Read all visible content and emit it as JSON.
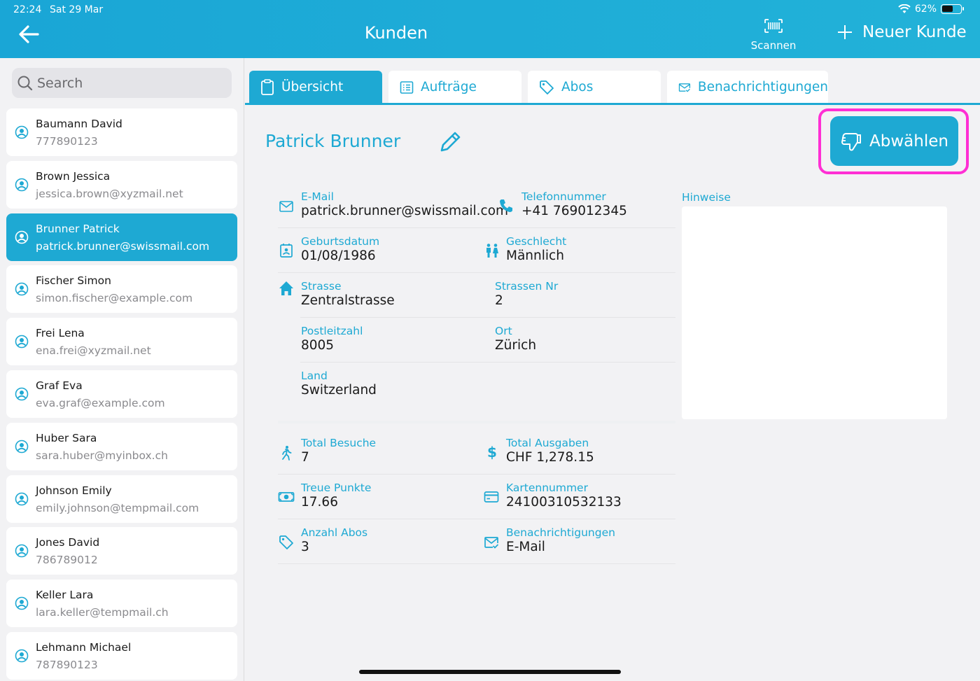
{
  "status_bar": {
    "time": "22:24",
    "date": "Sat 29 Mar",
    "battery": "62%"
  },
  "header": {
    "title": "Kunden",
    "scan_label": "Scannen",
    "new_label": "Neuer Kunde"
  },
  "search": {
    "placeholder": "Search"
  },
  "customers": [
    {
      "name": "Baumann David",
      "sub": "777890123"
    },
    {
      "name": "Brown Jessica",
      "sub": "jessica.brown@xyzmail.net"
    },
    {
      "name": "Brunner Patrick",
      "sub": "patrick.brunner@swissmail.com",
      "active": true
    },
    {
      "name": "Fischer Simon",
      "sub": "simon.fischer@example.com"
    },
    {
      "name": "Frei Lena",
      "sub": "ena.frei@xyzmail.net"
    },
    {
      "name": "Graf Eva",
      "sub": "eva.graf@example.com"
    },
    {
      "name": "Huber Sara",
      "sub": "sara.huber@myinbox.ch"
    },
    {
      "name": "Johnson Emily",
      "sub": "emily.johnson@tempmail.com"
    },
    {
      "name": "Jones David",
      "sub": "786789012"
    },
    {
      "name": "Keller Lara",
      "sub": "lara.keller@tempmail.ch"
    },
    {
      "name": "Lehmann Michael",
      "sub": "787890123"
    }
  ],
  "tabs": [
    {
      "label": "Übersicht",
      "active": true
    },
    {
      "label": "Aufträge"
    },
    {
      "label": "Abos"
    },
    {
      "label": "Benachrichtigungen"
    }
  ],
  "detail": {
    "name": "Patrick Brunner",
    "deselect_label": "Abwählen",
    "email": {
      "label": "E-Mail",
      "value": "patrick.brunner@swissmail.com"
    },
    "phone": {
      "label": "Telefonnummer",
      "value": "+41 769012345"
    },
    "birthdate": {
      "label": "Geburtsdatum",
      "value": "01/08/1986"
    },
    "gender": {
      "label": "Geschlecht",
      "value": "Männlich"
    },
    "street": {
      "label": "Strasse",
      "value": "Zentralstrasse"
    },
    "street_nr": {
      "label": "Strassen Nr",
      "value": "2"
    },
    "zip": {
      "label": "Postleitzahl",
      "value": "8005"
    },
    "city": {
      "label": "Ort",
      "value": "Zürich"
    },
    "country": {
      "label": "Land",
      "value": "Switzerland"
    },
    "visits": {
      "label": "Total Besuche",
      "value": "7"
    },
    "spend": {
      "label": "Total Ausgaben",
      "value": "CHF 1,278.15"
    },
    "points": {
      "label": "Treue Punkte",
      "value": "17.66"
    },
    "card": {
      "label": "Kartennummer",
      "value": "24100310532133"
    },
    "subs": {
      "label": "Anzahl Abos",
      "value": "3"
    },
    "notif": {
      "label": "Benachrichtigungen",
      "value": "E-Mail"
    },
    "notes_label": "Hinweise"
  },
  "colors": {
    "accent": "#1ea9d3",
    "highlight": "#ff2fd4"
  }
}
